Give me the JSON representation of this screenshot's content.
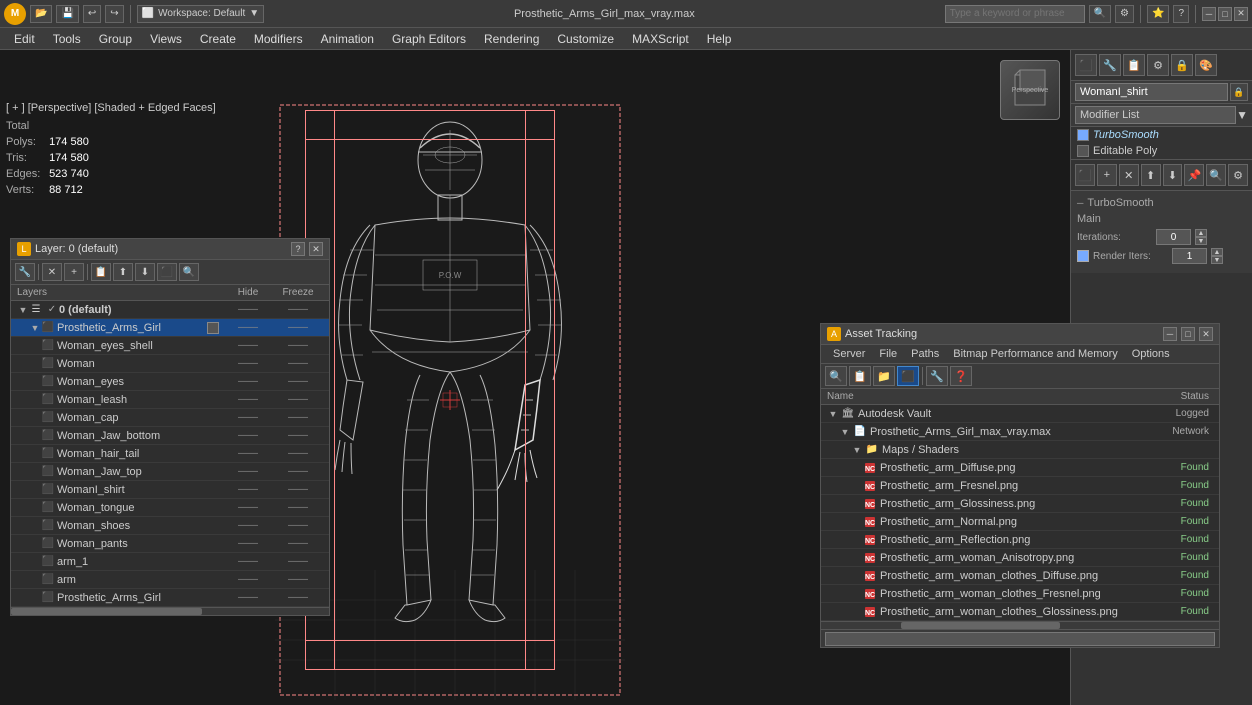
{
  "app": {
    "title": "Prosthetic_Arms_Girl_max_vray.max",
    "workspace": "Workspace: Default",
    "logo": "M"
  },
  "toolbar": {
    "buttons": [
      "↩",
      "↪",
      "□",
      "▷",
      "⊟",
      "⊞"
    ]
  },
  "search": {
    "placeholder": "Type a keyword or phrase"
  },
  "menu": {
    "items": [
      "Edit",
      "Tools",
      "Group",
      "Views",
      "Create",
      "Modifiers",
      "Animation",
      "Graph Editors",
      "Rendering",
      "Customize",
      "MAXScript",
      "Help"
    ]
  },
  "viewport": {
    "label": "[ + ] [Perspective] [Shaded + Edged Faces]"
  },
  "stats": {
    "header": "Total",
    "polys_label": "Polys:",
    "polys_value": "174 580",
    "tris_label": "Tris:",
    "tris_value": "174 580",
    "edges_label": "Edges:",
    "edges_value": "523 740",
    "verts_label": "Verts:",
    "verts_value": "88 712"
  },
  "right_panel": {
    "modifier_name": "WomanI_shirt",
    "modifier_list_label": "Modifier List",
    "modifiers": [
      {
        "name": "TurboSmooth",
        "active": true,
        "checked": true
      },
      {
        "name": "Editable Poly",
        "active": false,
        "checked": false
      }
    ],
    "turbosmooth": {
      "section": "TurboSmooth",
      "main_label": "Main",
      "iterations_label": "Iterations:",
      "iterations_value": "0",
      "render_iters_label": "Render Iters:",
      "render_iters_value": "1",
      "checkbox_label": "Render Iters"
    }
  },
  "layer_panel": {
    "title": "Layer: 0 (default)",
    "question": "?",
    "layers_header": "Layers",
    "hide_header": "Hide",
    "freeze_header": "Freeze",
    "items": [
      {
        "indent": 0,
        "type": "layer",
        "name": "0 (default)",
        "isDefault": true,
        "checked": true,
        "hasBox": false
      },
      {
        "indent": 1,
        "type": "object",
        "name": "Prosthetic_Arms_Girl",
        "isDefault": false,
        "checked": false,
        "selected": true,
        "hasBox": true
      },
      {
        "indent": 2,
        "type": "object",
        "name": "Woman_eyes_shell",
        "isDefault": false,
        "checked": false,
        "hasBox": false
      },
      {
        "indent": 2,
        "type": "object",
        "name": "Woman",
        "isDefault": false,
        "checked": false,
        "hasBox": false
      },
      {
        "indent": 2,
        "type": "object",
        "name": "Woman_eyes",
        "isDefault": false,
        "checked": false,
        "hasBox": false
      },
      {
        "indent": 2,
        "type": "object",
        "name": "Woman_leash",
        "isDefault": false,
        "checked": false,
        "hasBox": false
      },
      {
        "indent": 2,
        "type": "object",
        "name": "Woman_cap",
        "isDefault": false,
        "checked": false,
        "hasBox": false
      },
      {
        "indent": 2,
        "type": "object",
        "name": "Woman_Jaw_bottom",
        "isDefault": false,
        "checked": false,
        "hasBox": false
      },
      {
        "indent": 2,
        "type": "object",
        "name": "Woman_hair_tail",
        "isDefault": false,
        "checked": false,
        "hasBox": false
      },
      {
        "indent": 2,
        "type": "object",
        "name": "Woman_Jaw_top",
        "isDefault": false,
        "checked": false,
        "hasBox": false
      },
      {
        "indent": 2,
        "type": "object",
        "name": "WomanI_shirt",
        "isDefault": false,
        "checked": false,
        "hasBox": false
      },
      {
        "indent": 2,
        "type": "object",
        "name": "Woman_tongue",
        "isDefault": false,
        "checked": false,
        "hasBox": false
      },
      {
        "indent": 2,
        "type": "object",
        "name": "Woman_shoes",
        "isDefault": false,
        "checked": false,
        "hasBox": false
      },
      {
        "indent": 2,
        "type": "object",
        "name": "Woman_pants",
        "isDefault": false,
        "checked": false,
        "hasBox": false
      },
      {
        "indent": 2,
        "type": "object",
        "name": "arm_1",
        "isDefault": false,
        "checked": false,
        "hasBox": false
      },
      {
        "indent": 2,
        "type": "object",
        "name": "arm",
        "isDefault": false,
        "checked": false,
        "hasBox": false
      },
      {
        "indent": 2,
        "type": "object",
        "name": "Prosthetic_Arms_Girl",
        "isDefault": false,
        "checked": false,
        "hasBox": false
      }
    ]
  },
  "asset_panel": {
    "title": "Asset Tracking",
    "menu_items": [
      "Server",
      "File",
      "Paths",
      "Bitmap Performance and Memory",
      "Options"
    ],
    "columns": {
      "name": "Name",
      "status": "Status"
    },
    "items": [
      {
        "indent": 0,
        "type": "vault",
        "name": "Autodesk Vault",
        "status": "Logged",
        "status_type": "logged"
      },
      {
        "indent": 1,
        "type": "file",
        "name": "Prosthetic_Arms_Girl_max_vray.max",
        "status": "Network",
        "status_type": "network"
      },
      {
        "indent": 2,
        "type": "folder",
        "name": "Maps / Shaders",
        "status": "",
        "status_type": ""
      },
      {
        "indent": 3,
        "type": "texture",
        "name": "Prosthetic_arm_Diffuse.png",
        "status": "Found",
        "status_type": "found"
      },
      {
        "indent": 3,
        "type": "texture",
        "name": "Prosthetic_arm_Fresnel.png",
        "status": "Found",
        "status_type": "found"
      },
      {
        "indent": 3,
        "type": "texture",
        "name": "Prosthetic_arm_Glossiness.png",
        "status": "Found",
        "status_type": "found"
      },
      {
        "indent": 3,
        "type": "texture",
        "name": "Prosthetic_arm_Normal.png",
        "status": "Found",
        "status_type": "found"
      },
      {
        "indent": 3,
        "type": "texture",
        "name": "Prosthetic_arm_Reflection.png",
        "status": "Found",
        "status_type": "found"
      },
      {
        "indent": 3,
        "type": "texture",
        "name": "Prosthetic_arm_woman_Anisotropy.png",
        "status": "Found",
        "status_type": "found"
      },
      {
        "indent": 3,
        "type": "texture",
        "name": "Prosthetic_arm_woman_clothes_Diffuse.png",
        "status": "Found",
        "status_type": "found"
      },
      {
        "indent": 3,
        "type": "texture",
        "name": "Prosthetic_arm_woman_clothes_Fresnel.png",
        "status": "Found",
        "status_type": "found"
      },
      {
        "indent": 3,
        "type": "texture",
        "name": "Prosthetic_arm_woman_clothes_Glossiness.png",
        "status": "Found",
        "status_type": "found"
      }
    ]
  },
  "icons": {
    "expand": "▶",
    "collapse": "▼",
    "check": "✓",
    "close": "✕",
    "minimize": "─",
    "maximize": "□",
    "folder": "📁",
    "texture": "🖼",
    "vault": "🏛",
    "file_max": "📄"
  }
}
